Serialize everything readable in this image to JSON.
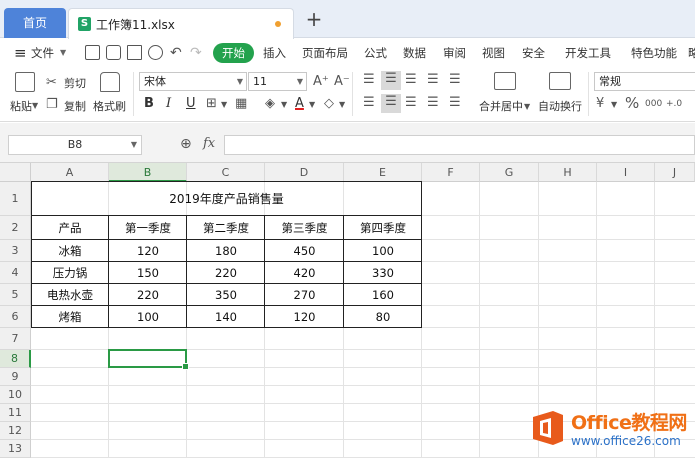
{
  "tabs": {
    "home": "首页",
    "file_icon": "S",
    "file": "工作簿11.xlsx",
    "new_tab": "+"
  },
  "menu": {
    "hamburger": "≡",
    "file": "文件",
    "items": [
      "开始",
      "插入",
      "页面布局",
      "公式",
      "数据",
      "审阅",
      "视图",
      "安全",
      "开发工具",
      "特色功能"
    ],
    "active_index": 0,
    "cut_off": "略"
  },
  "ribbon": {
    "paste": "粘贴",
    "cut": "剪切",
    "copy": "复制",
    "format_painter": "格式刷",
    "font_name": "宋体",
    "font_size": "11",
    "bold": "B",
    "italic": "I",
    "underline": "U",
    "font_color": "A",
    "grow_font": "A⁺",
    "shrink_font": "A⁻",
    "merge_center": "合并居中",
    "wrap_text": "自动换行",
    "number_format": "常规",
    "percent": "%",
    "thousands": "000",
    "decimal_add": "+.0",
    "decimal_sub": ".00"
  },
  "formula_bar": {
    "name_box": "B8",
    "fx": "fx",
    "content": ""
  },
  "columns": [
    "A",
    "B",
    "C",
    "D",
    "E",
    "F",
    "G",
    "H",
    "I",
    "J"
  ],
  "rows": [
    "1",
    "2",
    "3",
    "4",
    "5",
    "6",
    "7",
    "8",
    "9",
    "10",
    "11",
    "12",
    "13"
  ],
  "active": {
    "col": "B",
    "row": "8"
  },
  "table": {
    "title": "2019年度产品销售量",
    "headers": [
      "产品",
      "第一季度",
      "第二季度",
      "第三季度",
      "第四季度"
    ],
    "rows": [
      [
        "冰箱",
        "120",
        "180",
        "450",
        "100"
      ],
      [
        "压力锅",
        "150",
        "220",
        "420",
        "330"
      ],
      [
        "电热水壶",
        "220",
        "350",
        "270",
        "160"
      ],
      [
        "烤箱",
        "100",
        "140",
        "120",
        "80"
      ]
    ]
  },
  "watermark": {
    "brand": "Office教程网",
    "url": "www.office26.com"
  },
  "colors": {
    "accent_green": "#23a24d",
    "tab_blue": "#4e83d9",
    "select_green": "#2a9a45",
    "brand_orange": "#f07016"
  }
}
